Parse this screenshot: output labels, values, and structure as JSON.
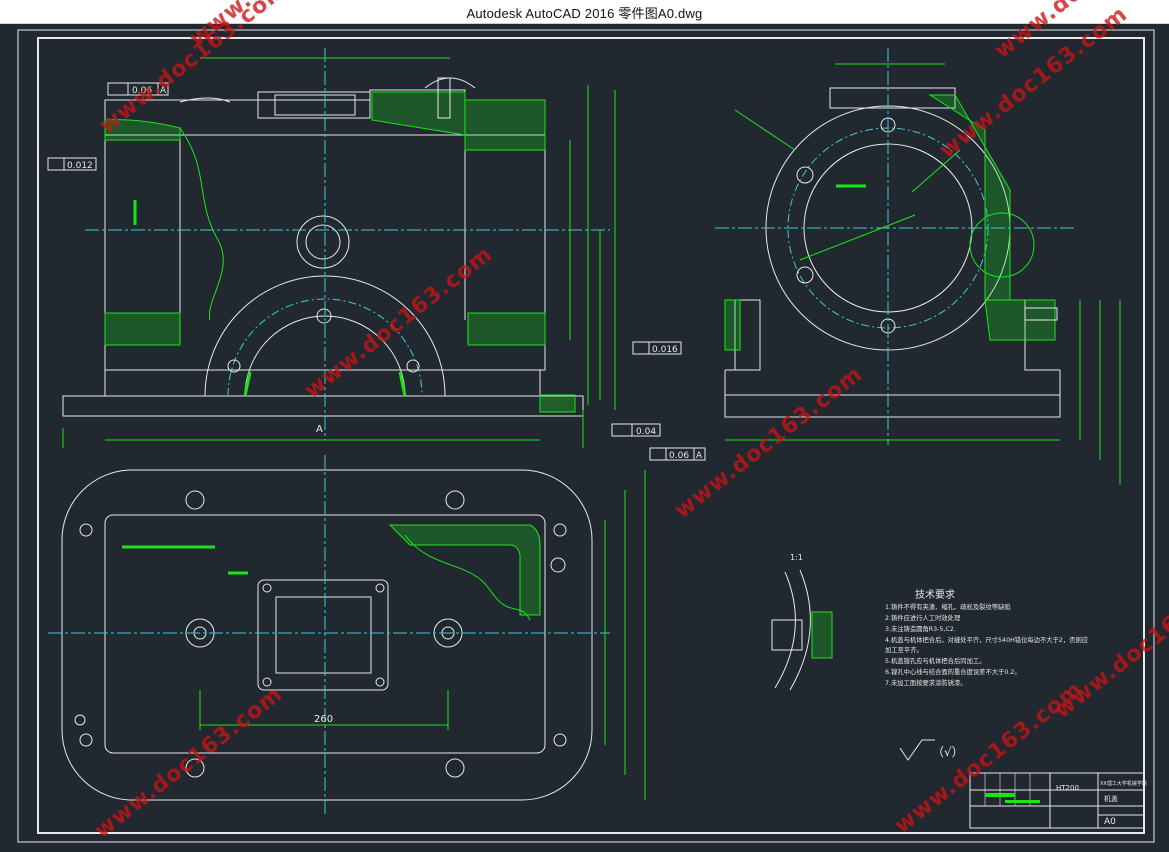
{
  "window": {
    "title": "Autodesk AutoCAD 2016     零件图A0.dwg"
  },
  "colors": {
    "background": "#212830",
    "line_white": "#e8e8e8",
    "line_green": "#19e619",
    "line_cyan": "#3fc9d6",
    "line_yellow": "#ffff33",
    "watermark": "#d01818"
  },
  "annotations": {
    "tol_006_top": "0.06",
    "tol_006_top_ref": "A",
    "tol_0012": "0.012",
    "tol_0016": "0.016",
    "tol_004": "0.04",
    "tol_006_mid": "0.06",
    "tol_006_mid_ref": "A",
    "dim_260": "260",
    "scale_detail": "1:1",
    "surface_symbol": "（√）"
  },
  "tech_requirements": {
    "heading": "技术要求",
    "lines": [
      "1.铸件不得有夹渣、缩孔、疏松及裂纹等缺陷",
      "2.铸件应进行人工时效处理",
      "3.未注铸造圆角R3-5,C2.",
      "4.机盖与机体把合后，对缝处平齐，尺寸540H错位每边不大于2，否则应",
      "  加工至平齐。",
      "5.机盖镗孔应与机体把合后同加工。",
      "6.镗孔中心线与结合面的重合度误差不大于0.2。",
      "7.未加工面按要求涂防锈漆。"
    ]
  },
  "title_block": {
    "code": "HT200",
    "part_name": "机盖",
    "sheet_size": "A0",
    "school": "XX理工大学机械学院"
  },
  "watermarks": [
    "www.doc163.com",
    "www.doc163.com",
    "www.doc163.com",
    "www.doc163.com",
    "www.doc163.com",
    "www.doc163.com",
    "www.doc163.com",
    "www.doc163.com",
    "www.doc163.com"
  ]
}
